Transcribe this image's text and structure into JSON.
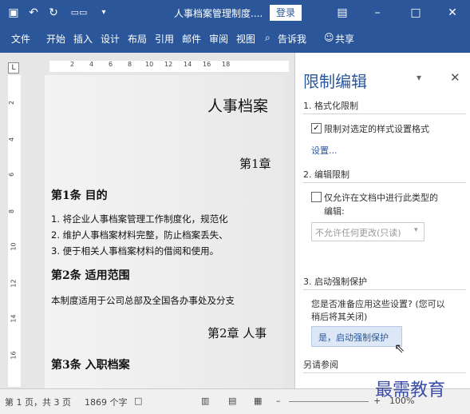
{
  "titlebar": {
    "save_icon": "save-icon",
    "undo_icon": "undo-icon",
    "redo_icon": "redo-icon",
    "customize_icon": "quick-access-icon",
    "document_title": "人事档案管理制度....",
    "login_label": "登录",
    "ribbon_display_icon": "ribbon-display-icon",
    "minimize_icon": "minimize-icon",
    "maximize_icon": "maximize-icon",
    "close_icon": "close-icon"
  },
  "ribbon_tabs": {
    "items": [
      "文件",
      "开始",
      "插入",
      "设计",
      "布局",
      "引用",
      "邮件",
      "审阅",
      "视图"
    ],
    "tell_me": "告诉我",
    "share": "共享"
  },
  "ruler": {
    "corner": "L",
    "h_ticks": [
      "2",
      "4",
      "6",
      "8",
      "10",
      "12",
      "14",
      "16",
      "18"
    ],
    "v_ticks": [
      "2",
      "4",
      "6",
      "8",
      "10",
      "12",
      "14",
      "16"
    ]
  },
  "document": {
    "title": "人事档案",
    "chapter1": "第1章",
    "article1": "第1条  目的",
    "item1": "1.  将企业人事档案管理工作制度化，规范化",
    "item2": "2.  维护人事档案材料完整，防止档案丢失、",
    "item3": "3.  便于相关人事档案材料的借阅和使用。",
    "article2": "第2条  适用范围",
    "scope": "本制度适用于公司总部及全国各办事处及分支",
    "chapter2": "第2章 人事",
    "article3": "第3条  入职档案"
  },
  "pane": {
    "title": "限制编辑",
    "dropdown_icon": "dropdown-icon",
    "close_icon": "close-icon",
    "section1": "1. 格式化限制",
    "format_check_label": "限制对选定的样式设置格式",
    "format_checked": true,
    "settings_link": "设置...",
    "section2": "2. 编辑限制",
    "edit_check_label_1": "仅允许在文档中进行此类型的",
    "edit_check_label_2": "编辑:",
    "edit_checked": false,
    "edit_select_value": "不允许任何更改(只读)",
    "section3": "3. 启动强制保护",
    "question_1": "您是否准备应用这些设置? (您可以",
    "question_2": "稍后将其关闭)",
    "start_button": "是，启动强制保护",
    "see_also": "另请参阅"
  },
  "statusbar": {
    "page": "第 1 页，共 3 页",
    "words": "1869 个字",
    "zoom": "100%"
  },
  "watermark": "最需教育"
}
